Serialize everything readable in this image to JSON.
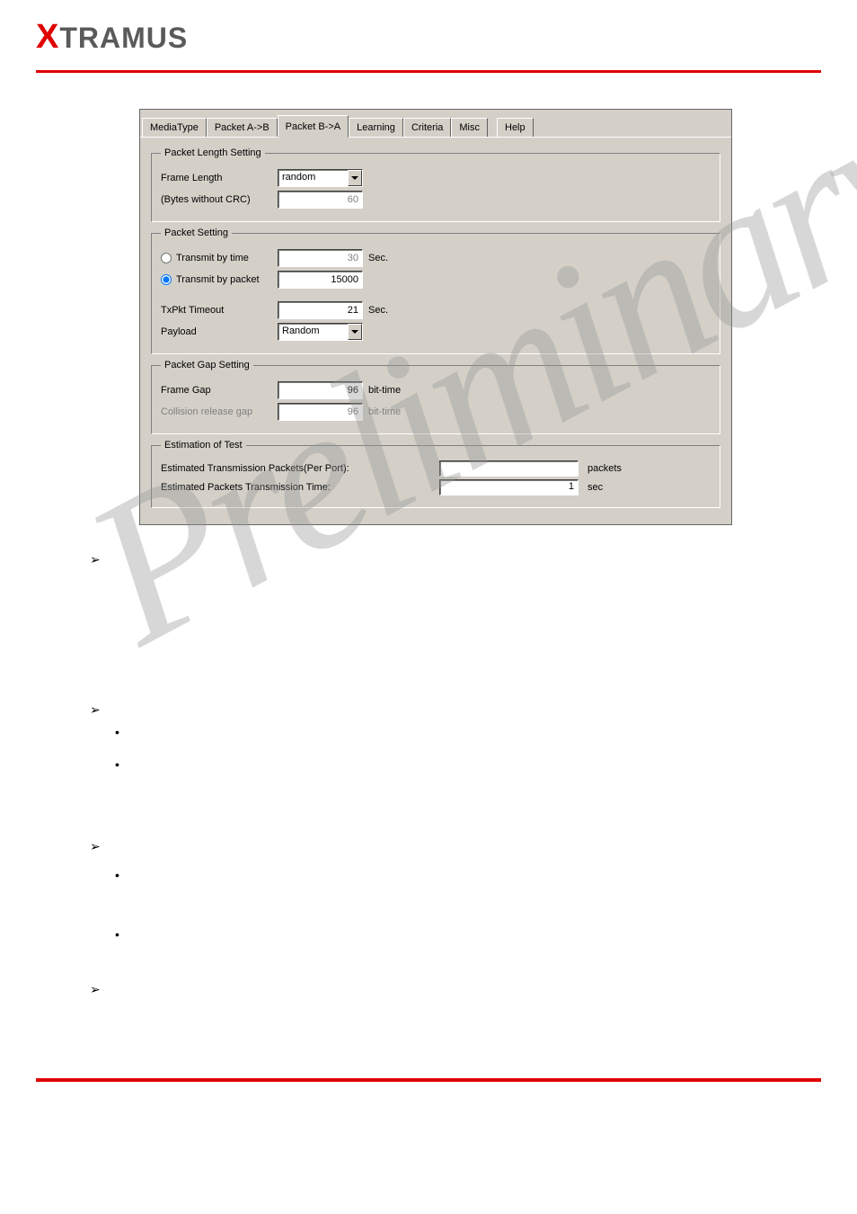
{
  "header": {
    "logo_x": "X",
    "logo_rest": "TRAMUS"
  },
  "tabs": {
    "mediatype": "MediaType",
    "packet_ab": "Packet A->B",
    "packet_ba": "Packet B->A",
    "learning": "Learning",
    "criteria": "Criteria",
    "misc": "Misc",
    "help": "Help"
  },
  "groups": {
    "packet_length": {
      "legend": "Packet Length Setting",
      "frame_length_label": "Frame Length",
      "frame_length_value": "random",
      "bytes_label": "(Bytes without CRC)",
      "bytes_value": "60"
    },
    "packet_setting": {
      "legend": "Packet Setting",
      "transmit_time_label": "Transmit by time",
      "transmit_time_value": "30",
      "transmit_time_unit": "Sec.",
      "transmit_packet_label": "Transmit by packet",
      "transmit_packet_value": "15000",
      "txpkt_label": "TxPkt Timeout",
      "txpkt_value": "21",
      "txpkt_unit": "Sec.",
      "payload_label": "Payload",
      "payload_value": "Random"
    },
    "packet_gap": {
      "legend": "Packet Gap Setting",
      "frame_gap_label": "Frame Gap",
      "frame_gap_value": "96",
      "frame_gap_unit": "bit-time",
      "collision_label": "Collision release gap",
      "collision_value": "96",
      "collision_unit": "bit-time"
    },
    "estimation": {
      "legend": "Estimation of Test",
      "est_packets_label": "Estimated Transmission Packets(Per Port):",
      "est_packets_value": "",
      "est_packets_unit": "packets",
      "est_time_label": "Estimated Packets Transmission Time:",
      "est_time_value": "1",
      "est_time_unit": "sec"
    }
  },
  "watermark": "Preliminary"
}
